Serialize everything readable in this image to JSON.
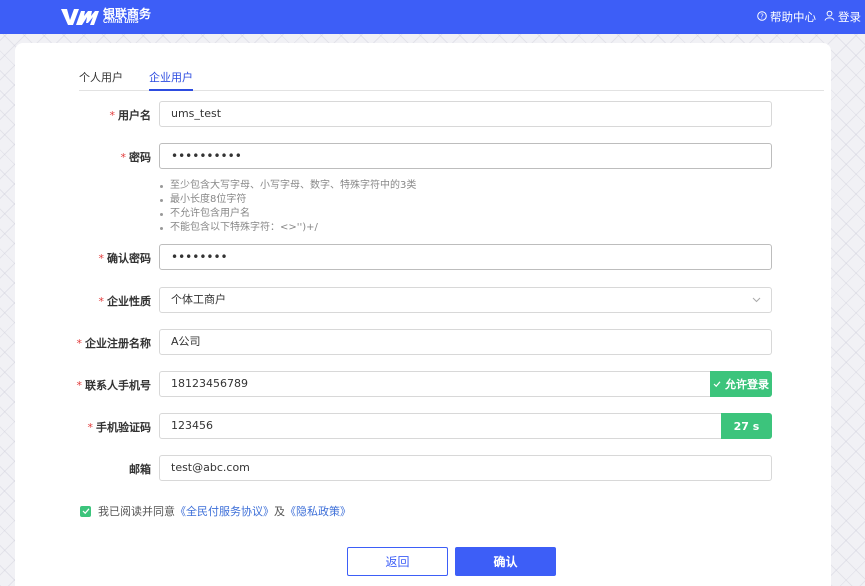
{
  "header": {
    "brand_cn": "银联商务",
    "brand_en": "China ums",
    "help_label": "帮助中心",
    "login_label": "登录"
  },
  "tabs": [
    {
      "label": "个人用户",
      "active": false
    },
    {
      "label": "企业用户",
      "active": true
    }
  ],
  "form": {
    "username": {
      "label": "用户名",
      "value": "ums_test"
    },
    "password": {
      "label": "密码",
      "value": "••••••••••"
    },
    "password_hints": [
      "至少包含大写字母、小写字母、数字、特殊字符中的3类",
      "最小长度8位字符",
      "不允许包含用户名",
      "不能包含以下特殊字符：<>'')+/"
    ],
    "confirm_password": {
      "label": "确认密码",
      "value": "••••••••"
    },
    "enterprise_type": {
      "label": "企业性质",
      "value": "个体工商户"
    },
    "enterprise_name": {
      "label": "企业注册名称",
      "value": "A公司"
    },
    "contact_phone": {
      "label": "联系人手机号",
      "value": "18123456789",
      "action": "允许登录"
    },
    "sms_code": {
      "label": "手机验证码",
      "value": "123456",
      "countdown": "27 s"
    },
    "email": {
      "label": "邮箱",
      "value": "test@abc.com"
    }
  },
  "agreement": {
    "prefix": "我已阅读并同意",
    "link1": "《全民付服务协议》",
    "joiner": "及",
    "link2": "《隐私政策》",
    "checked": true
  },
  "buttons": {
    "back": "返回",
    "confirm": "确认"
  },
  "colors": {
    "primary": "#3d5ef7",
    "success": "#3cc47c",
    "required": "#e23b3b"
  }
}
